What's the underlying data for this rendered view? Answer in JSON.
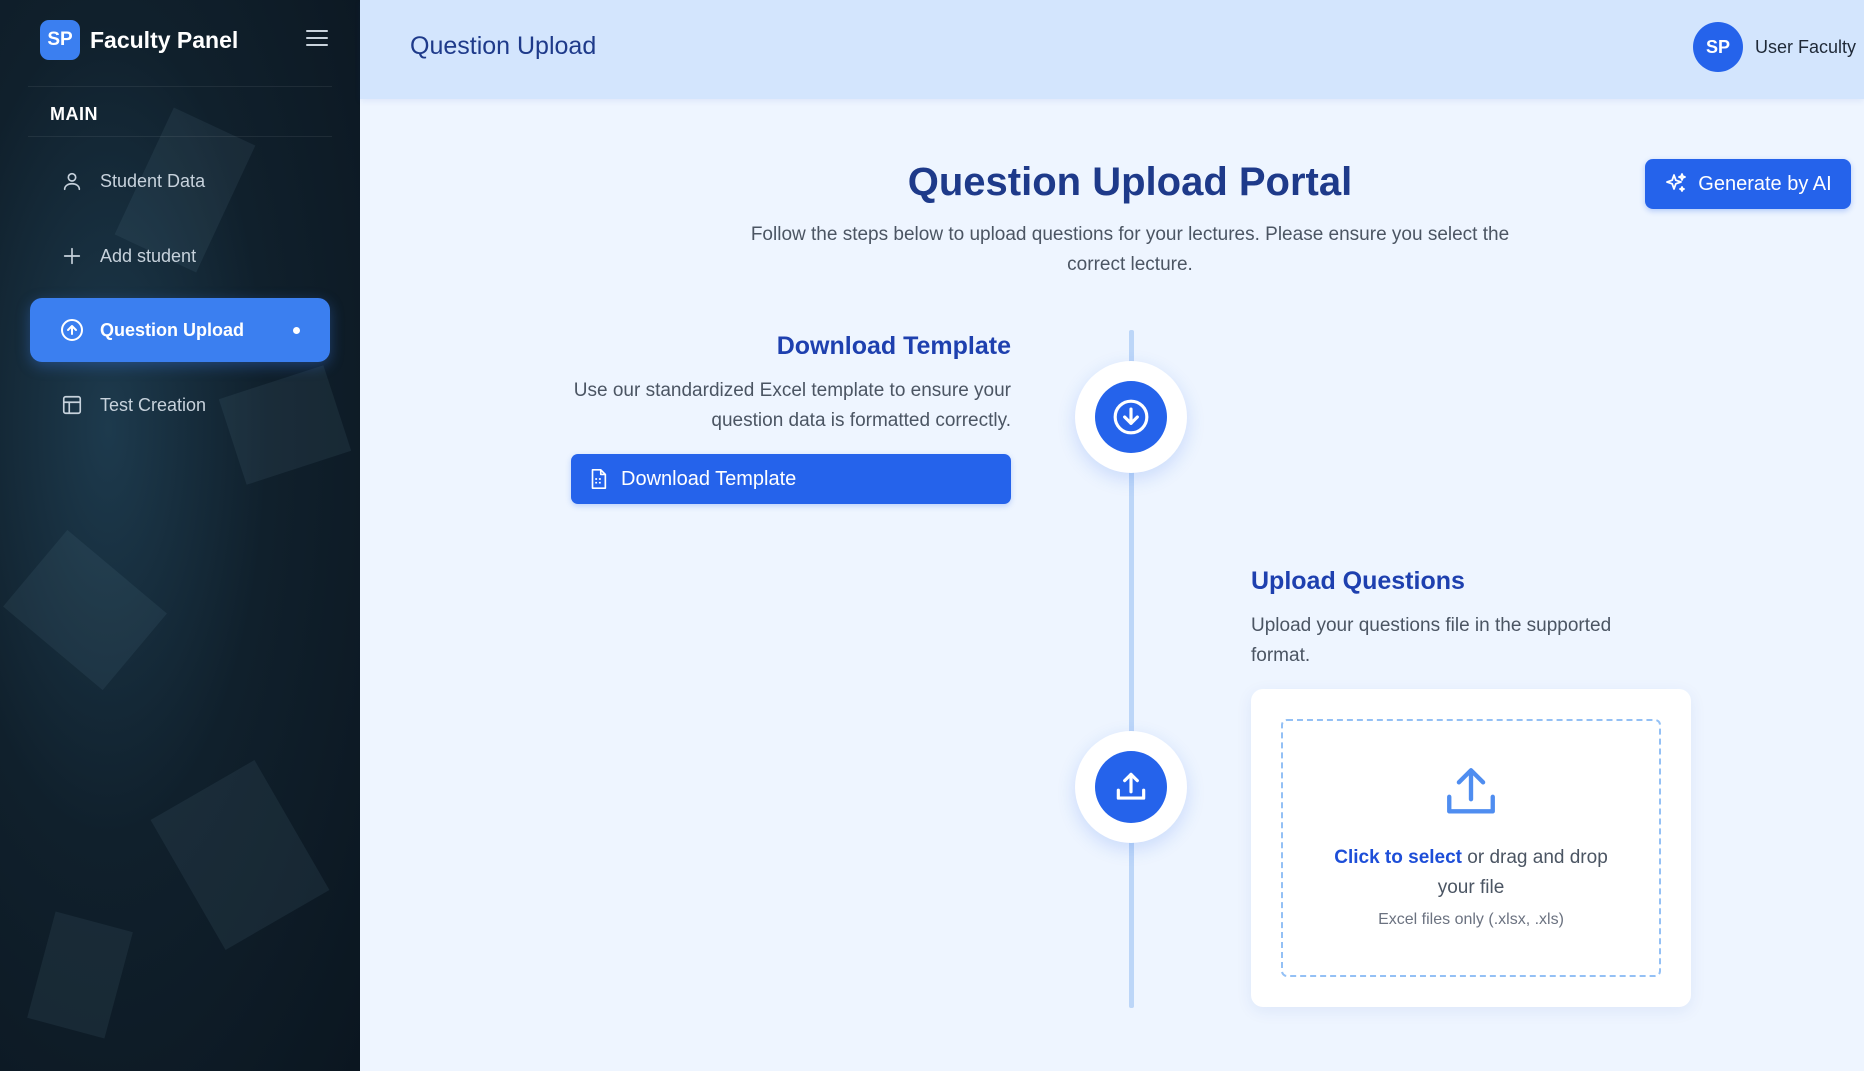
{
  "sidebar": {
    "brand_logo": "SP",
    "brand_title": "Faculty Panel",
    "section_label": "MAIN",
    "items": [
      {
        "label": "Student Data",
        "icon": "user-icon"
      },
      {
        "label": "Add student",
        "icon": "plus-icon"
      },
      {
        "label": "Question Upload",
        "icon": "upload-circle-icon",
        "active": true
      },
      {
        "label": "Test Creation",
        "icon": "table-icon"
      }
    ]
  },
  "header": {
    "title": "Question Upload",
    "user_initials": "SP",
    "user_name": "User Faculty"
  },
  "main": {
    "title": "Question Upload Portal",
    "description": "Follow the steps below to upload questions for your lectures. Please ensure you select the correct lecture.",
    "ai_button_label": "Generate by AI",
    "step1": {
      "title": "Download Template",
      "description": "Use our standardized Excel template to ensure your question data is formatted correctly.",
      "button_label": "Download Template"
    },
    "step2": {
      "title": "Upload Questions",
      "description": "Upload your questions file in the supported format.",
      "link_text": "Click to select",
      "drop_text": " or drag and drop your file",
      "hint": "Excel files only (.xlsx, .xls)"
    }
  },
  "colors": {
    "accent": "#2563eb",
    "active_nav": "#3b7ff0",
    "title": "#1e3a8a",
    "header_bg": "#d3e5fd",
    "page_bg": "#eef5ff"
  }
}
